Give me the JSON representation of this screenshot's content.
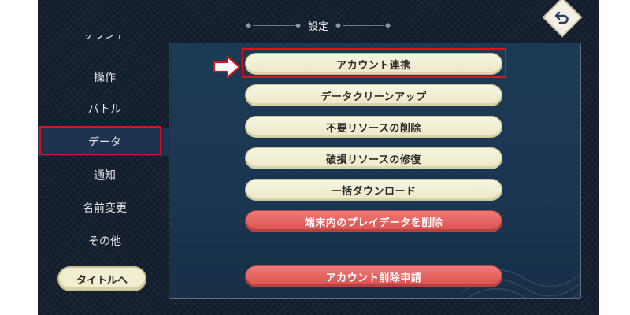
{
  "header": {
    "title": "設定"
  },
  "sidebar": {
    "items": [
      {
        "label": "サウンド",
        "active": false
      },
      {
        "label": "操作",
        "active": false
      },
      {
        "label": "バトル",
        "active": false
      },
      {
        "label": "データ",
        "active": true
      },
      {
        "label": "通知",
        "active": false
      },
      {
        "label": "名前変更",
        "active": false
      },
      {
        "label": "その他",
        "active": false
      }
    ],
    "title_button": "タイトルへ"
  },
  "data_menu": {
    "buttons": [
      {
        "label": "アカウント連携",
        "style": "cream"
      },
      {
        "label": "データクリーンアップ",
        "style": "cream"
      },
      {
        "label": "不要リソースの削除",
        "style": "cream"
      },
      {
        "label": "破損リソースの修復",
        "style": "cream"
      },
      {
        "label": "一括ダウンロード",
        "style": "cream"
      },
      {
        "label": "端末内のプレイデータを削除",
        "style": "red"
      }
    ],
    "delete_request": "アカウント削除申請"
  },
  "colors": {
    "accent_red_box": "#d8141c",
    "cream_button": "#f0edcf",
    "danger_button": "#e0605c",
    "panel_bg": "#1c3853",
    "screen_bg": "#131d2b"
  },
  "icons": {
    "back": "return-arrow-icon",
    "pointer": "right-arrow-icon"
  }
}
